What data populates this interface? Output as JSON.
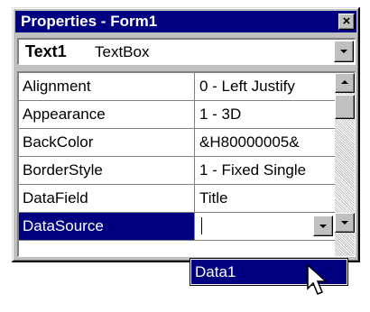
{
  "window": {
    "title": "Properties - Form1",
    "close_glyph": "×",
    "close_icon": "close-icon"
  },
  "object_selector": {
    "name": "Text1",
    "type": "TextBox",
    "arrow_icon": "chevron-down-icon"
  },
  "properties": [
    {
      "name": "Alignment",
      "value": "0 - Left Justify"
    },
    {
      "name": "Appearance",
      "value": "1 - 3D"
    },
    {
      "name": "BackColor",
      "value": "&H80000005&"
    },
    {
      "name": "BorderStyle",
      "value": "1 - Fixed Single"
    },
    {
      "name": "DataField",
      "value": "Title"
    },
    {
      "name": "DataSource",
      "value": ""
    }
  ],
  "selected_property_index": 5,
  "dropdown": {
    "items": [
      "Data1"
    ],
    "highlighted": "Data1"
  },
  "colors": {
    "title_bar": "#000080",
    "selection": "#000080",
    "face": "#c0c0c0"
  },
  "icons": {
    "scroll_up": "scroll-up-arrow-icon",
    "scroll_down": "scroll-down-arrow-icon",
    "cursor": "mouse-pointer-icon"
  }
}
